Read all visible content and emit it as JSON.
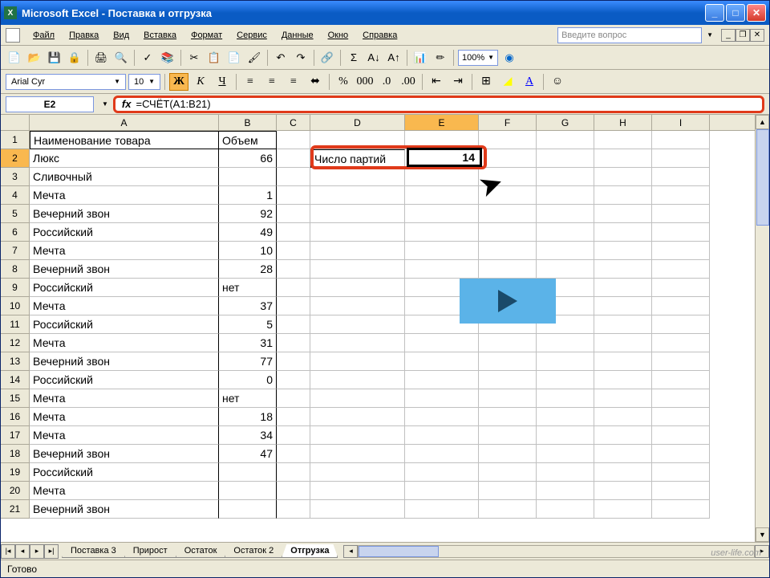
{
  "titlebar": {
    "app": "Microsoft Excel",
    "doc": "Поставка и отгрузка"
  },
  "menus": [
    "Файл",
    "Правка",
    "Вид",
    "Вставка",
    "Формат",
    "Сервис",
    "Данные",
    "Окно",
    "Справка"
  ],
  "ask_placeholder": "Введите вопрос",
  "zoom": "100%",
  "font_name": "Arial Cyr",
  "font_size": "10",
  "name_box": "E2",
  "formula": "=СЧЁТ(A1:B21)",
  "columns": [
    "A",
    "B",
    "C",
    "D",
    "E",
    "F",
    "G",
    "H",
    "I"
  ],
  "headers": {
    "A": "Наименование товара",
    "B": "Объем"
  },
  "d2_label": "Число партий",
  "e2_value": "14",
  "rows": [
    {
      "n": 1,
      "a": "Наименование товара",
      "b": "Объем",
      "btxt": true
    },
    {
      "n": 2,
      "a": "Люкс",
      "b": "66"
    },
    {
      "n": 3,
      "a": "Сливочный",
      "b": ""
    },
    {
      "n": 4,
      "a": "Мечта",
      "b": "1"
    },
    {
      "n": 5,
      "a": "Вечерний звон",
      "b": "92"
    },
    {
      "n": 6,
      "a": "Российский",
      "b": "49"
    },
    {
      "n": 7,
      "a": "Мечта",
      "b": "10"
    },
    {
      "n": 8,
      "a": "Вечерний звон",
      "b": "28"
    },
    {
      "n": 9,
      "a": "Российский",
      "b": "нет",
      "btxt": true
    },
    {
      "n": 10,
      "a": "Мечта",
      "b": "37"
    },
    {
      "n": 11,
      "a": "Российский",
      "b": "5"
    },
    {
      "n": 12,
      "a": "Мечта",
      "b": "31"
    },
    {
      "n": 13,
      "a": "Вечерний звон",
      "b": "77"
    },
    {
      "n": 14,
      "a": "Российский",
      "b": "0"
    },
    {
      "n": 15,
      "a": "Мечта",
      "b": "нет",
      "btxt": true
    },
    {
      "n": 16,
      "a": "Мечта",
      "b": "18"
    },
    {
      "n": 17,
      "a": "Мечта",
      "b": "34"
    },
    {
      "n": 18,
      "a": "Вечерний звон",
      "b": "47"
    },
    {
      "n": 19,
      "a": "Российский",
      "b": ""
    },
    {
      "n": 20,
      "a": "Мечта",
      "b": ""
    },
    {
      "n": 21,
      "a": "Вечерний звон",
      "b": ""
    }
  ],
  "tabs": [
    "Поставка 3",
    "Прирост",
    "Остаток",
    "Остаток 2",
    "Отгрузка"
  ],
  "active_tab": "Отгрузка",
  "status": "Готово",
  "watermark": "user-life.com",
  "fmt_labels": {
    "bold": "Ж",
    "italic": "К",
    "underline": "Ч"
  }
}
